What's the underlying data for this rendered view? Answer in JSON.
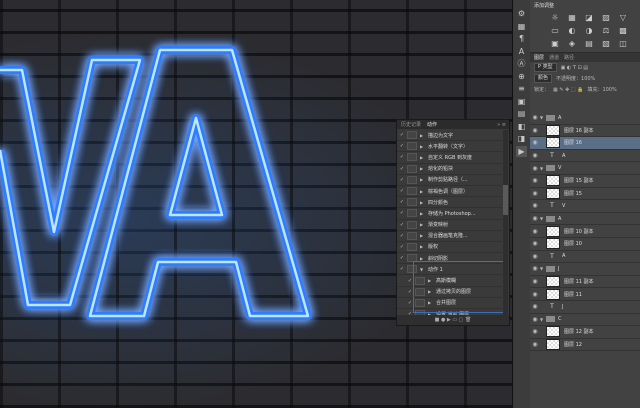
{
  "history_panel": {
    "tabs": [
      "历史记录",
      "动作"
    ],
    "menu_icons": "»  ≡",
    "rows": [
      {
        "label": "描边为文字",
        "kind": "item"
      },
      {
        "label": "水平翻转（文字）",
        "kind": "item"
      },
      {
        "label": "自定义 RGB 到灰度",
        "kind": "item"
      },
      {
        "label": "熔化的铅块",
        "kind": "item"
      },
      {
        "label": "制作剪贴路径（...",
        "kind": "item"
      },
      {
        "label": "棕褐色调（图层）",
        "kind": "item"
      },
      {
        "label": "四分颜色",
        "kind": "item"
      },
      {
        "label": "存储为 Photoshop...",
        "kind": "item"
      },
      {
        "label": "渐变映射",
        "kind": "item"
      },
      {
        "label": "混合器画笔克隆...",
        "kind": "item"
      },
      {
        "label": "版权",
        "kind": "item"
      },
      {
        "label": "斜切阴影",
        "kind": "item"
      },
      {
        "label": "动作 1",
        "kind": "open"
      },
      {
        "label": "高斯模糊",
        "kind": "sub"
      },
      {
        "label": "通过拷贝的图层",
        "kind": "sub"
      },
      {
        "label": "合并图层",
        "kind": "sub"
      },
      {
        "label": "设置 当前 图层",
        "kind": "sub"
      }
    ],
    "bottom_icons": "■  ●  ▶  ▭  ▢  🗑"
  },
  "adjustments": {
    "title": "添加调整",
    "icons": [
      "☼",
      "▦",
      "◪",
      "▨",
      "▽",
      "▭",
      "◐",
      "◑",
      "⚖",
      "▩",
      "▣",
      "◈",
      "▤",
      "▧",
      "◫"
    ]
  },
  "layers_panel": {
    "tabs": [
      "图层",
      "通道",
      "路径"
    ],
    "filter_label": "P 类型",
    "blend_mode": "颜色",
    "opacity_label": "不透明度：100%",
    "lock_label": "锁定：",
    "fill_label": "填充：100%",
    "rows": [
      {
        "label": "A",
        "type": "group"
      },
      {
        "label": "图层 16 副本",
        "type": "layer"
      },
      {
        "label": "图层 16",
        "type": "layer",
        "selected": true
      },
      {
        "label": "A",
        "type": "text"
      },
      {
        "label": "V",
        "type": "group"
      },
      {
        "label": "图层 15 副本",
        "type": "layer"
      },
      {
        "label": "图层 15",
        "type": "layer"
      },
      {
        "label": "V",
        "type": "text"
      },
      {
        "label": "A",
        "type": "group"
      },
      {
        "label": "图层 10 副本",
        "type": "layer"
      },
      {
        "label": "图层 10",
        "type": "layer"
      },
      {
        "label": "A",
        "type": "text"
      },
      {
        "label": "J",
        "type": "group"
      },
      {
        "label": "图层 11 副本",
        "type": "layer"
      },
      {
        "label": "图层 11",
        "type": "layer"
      },
      {
        "label": "J",
        "type": "text"
      },
      {
        "label": "C",
        "type": "group"
      },
      {
        "label": "图层 12 副本",
        "type": "layer"
      },
      {
        "label": "图层 12",
        "type": "layer"
      }
    ]
  },
  "tool_icons": [
    "⚙",
    "▦",
    "¶",
    "A",
    "Ⓐ",
    "⊕",
    "≡",
    "▣",
    "▤",
    "◧",
    "◨",
    "▶"
  ],
  "neon": {
    "glow_color": "#2f7dff",
    "core_color": "#bfe6ff"
  }
}
